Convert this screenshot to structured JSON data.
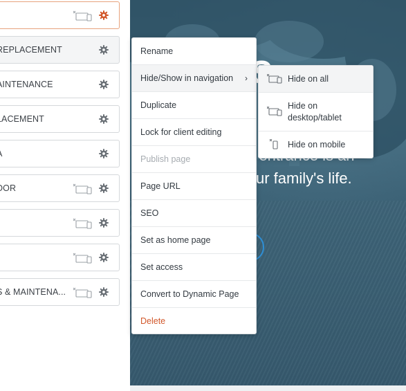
{
  "pages_panel": {
    "rows": [
      {
        "label": "",
        "hidden": true,
        "active": true
      },
      {
        "label": "REPLACEMENT",
        "hidden": false,
        "highlight": true
      },
      {
        "label": "AINTENANCE",
        "hidden": false
      },
      {
        "label": "LACEMENT",
        "hidden": false
      },
      {
        "label": "A",
        "hidden": false
      },
      {
        "label": "DOR",
        "hidden": true
      },
      {
        "label": "",
        "hidden": true
      },
      {
        "label": "",
        "hidden": true
      },
      {
        "label": "S & MAINTENA...",
        "hidden": true
      }
    ]
  },
  "preview": {
    "hero_big": "ius",
    "hero_line1": "e entrance is an",
    "hero_line2": "ur family's life."
  },
  "context_menu": {
    "items": [
      {
        "label": "Rename"
      },
      {
        "label": "Hide/Show in navigation",
        "submenu": true,
        "state": "hover"
      },
      {
        "label": "Duplicate"
      },
      {
        "label": "Lock for client editing"
      },
      {
        "label": "Publish page",
        "state": "disabled"
      },
      {
        "label": "Page URL"
      },
      {
        "label": "SEO"
      },
      {
        "label": "Set as home page"
      },
      {
        "label": "Set access"
      },
      {
        "label": "Convert to Dynamic Page"
      },
      {
        "label": "Delete",
        "state": "danger"
      }
    ]
  },
  "submenu": {
    "items": [
      {
        "line1": "Hide on all",
        "line2": "",
        "icon": "all-devices-hidden-icon",
        "state": "hover"
      },
      {
        "line1": "Hide on",
        "line2": "desktop/tablet",
        "icon": "desktop-tablet-hidden-icon"
      },
      {
        "line1": "Hide on mobile",
        "line2": "",
        "icon": "mobile-hidden-icon"
      }
    ]
  },
  "colors": {
    "accent_orange": "#d2582b",
    "active_border": "#e7a27c",
    "icon_gray": "#6b7177",
    "preview_blue": "#3d6377"
  }
}
